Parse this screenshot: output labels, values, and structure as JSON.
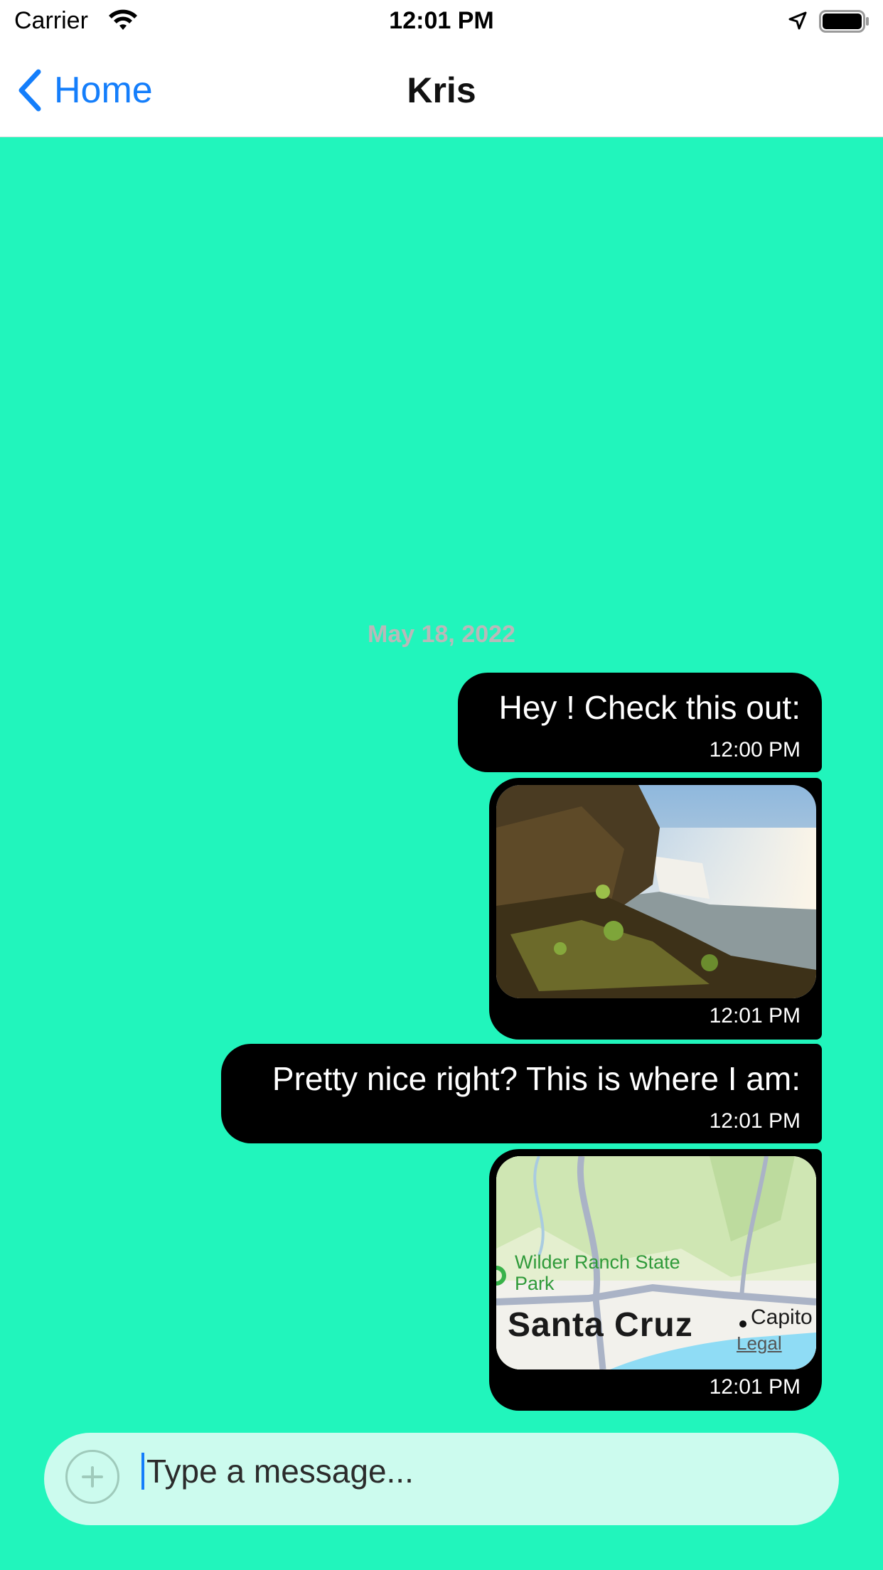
{
  "status_bar": {
    "carrier": "Carrier",
    "time": "12:01 PM",
    "icons": [
      "wifi-icon",
      "location-arrow-icon",
      "battery-icon"
    ]
  },
  "nav": {
    "back_label": "Home",
    "title": "Kris",
    "back_icon": "chevron-left-icon",
    "accent_color": "#147EFB"
  },
  "chat": {
    "background_color": "#21F5BC",
    "bubble_color": "#000000",
    "date_header": "May 18, 2022",
    "messages": [
      {
        "type": "text",
        "text": "Hey ! Check this out:",
        "time": "12:00 PM"
      },
      {
        "type": "image",
        "image": "waterfall-photo",
        "time": "12:01 PM"
      },
      {
        "type": "text",
        "text": "Pretty nice right? This is where I am:",
        "time": "12:01 PM"
      },
      {
        "type": "location",
        "map_labels": {
          "park": "Wilder Ranch State Park",
          "city": "Santa Cruz",
          "nearby": "Capito",
          "legal": "Legal"
        },
        "time": "12:01 PM"
      }
    ]
  },
  "input": {
    "placeholder": "Type a message...",
    "value": "",
    "add_icon": "plus-circle-icon"
  }
}
